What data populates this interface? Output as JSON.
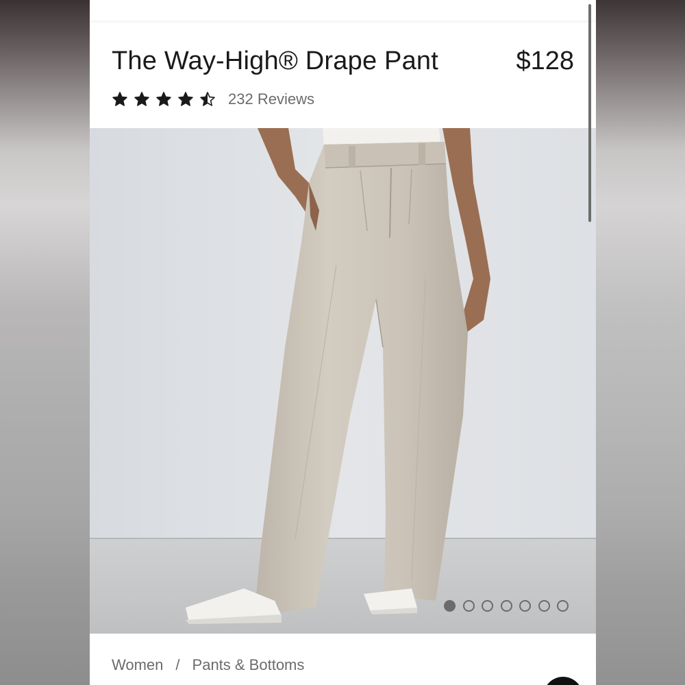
{
  "product": {
    "title": "The Way-High® Drape Pant",
    "price": "$128",
    "rating": 4.5,
    "rating_max": 5,
    "reviews_label": "232 Reviews"
  },
  "gallery": {
    "total_images": 7,
    "active_index": 0,
    "image_icon": "product-photo-beige-wide-leg-pants"
  },
  "breadcrumb": {
    "items": [
      "Women",
      "Pants & Bottoms"
    ],
    "separator": "/"
  },
  "colors": {
    "text_primary": "#1a1a1a",
    "text_secondary": "#6b6b6b",
    "pant_color": "#cfc7bc",
    "backdrop_wall": "#dfe2e6",
    "floor": "#c9cacb"
  }
}
